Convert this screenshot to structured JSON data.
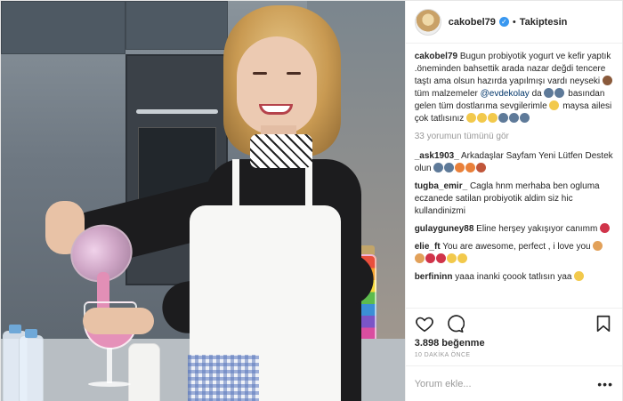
{
  "post": {
    "username": "cakobel79",
    "follow_label": "Takiptesin",
    "caption_user": "cakobel79",
    "caption_text_1": "Bugun probiyotik yogurt ve kefir yaptık .öneminden bahsettik arada nazar değdi tencere taştı ama olsun hazırda yapılmışı vardı neyseki ",
    "caption_text_2": "tüm malzemeler ",
    "caption_mention": "@evdekolay",
    "caption_text_3": " da",
    "caption_text_4": " basından gelen tüm dostlarıma sevgilerimle",
    "caption_text_5": "maysa ailesi çok tatlısınız",
    "view_all_comments": "33 yorumun tümünü gör",
    "comments": [
      {
        "user": "_ask1903_",
        "text": " Arkadaşlar Sayfam Yeni Lütfen Destek olun"
      },
      {
        "user": "tugba_emir_",
        "text": " Cagla hnm merhaba ben ogluma eczanede satilan probiyotik aldim siz hic kullandinizmi"
      },
      {
        "user": "gulayguney88",
        "text": " Eline herşey yakışıyor canımm"
      },
      {
        "user": "elie_ft",
        "text": " You are awesome, perfect , i love you"
      },
      {
        "user": "berfininn",
        "text": " yaaa inanki çoook tatlısın yaa"
      }
    ],
    "likes": "3.898 beğenme",
    "time": "10 DAKİKA ÖNCE",
    "comment_placeholder": "Yorum ekle...",
    "more_options": "•••"
  },
  "icons": [
    "like-icon",
    "comment-icon",
    "bookmark-icon",
    "verified-icon"
  ],
  "colors": {
    "link": "#003569",
    "verified": "#3897f0",
    "muted": "#999999"
  }
}
